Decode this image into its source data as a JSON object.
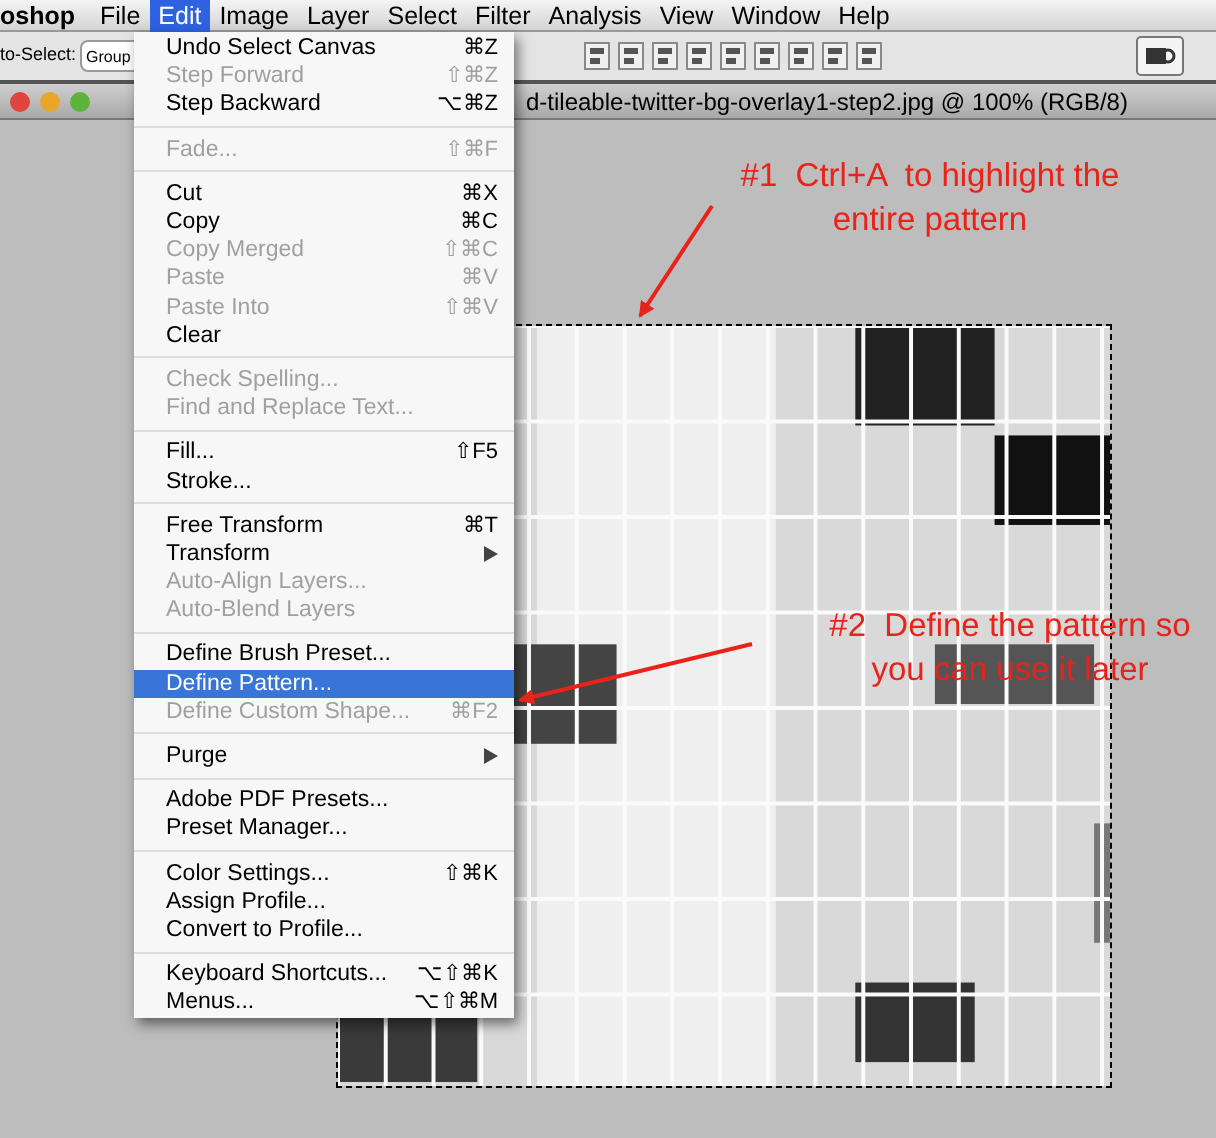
{
  "menubar": [
    {
      "label": "oshop",
      "kind": "app",
      "selected": false
    },
    {
      "label": "File",
      "kind": "menu",
      "selected": false
    },
    {
      "label": "Edit",
      "kind": "menu",
      "selected": true
    },
    {
      "label": "Image",
      "kind": "menu",
      "selected": false
    },
    {
      "label": "Layer",
      "kind": "menu",
      "selected": false
    },
    {
      "label": "Select",
      "kind": "menu",
      "selected": false
    },
    {
      "label": "Filter",
      "kind": "menu",
      "selected": false
    },
    {
      "label": "Analysis",
      "kind": "menu",
      "selected": false
    },
    {
      "label": "View",
      "kind": "menu",
      "selected": false
    },
    {
      "label": "Window",
      "kind": "menu",
      "selected": false
    },
    {
      "label": "Help",
      "kind": "menu",
      "selected": false
    }
  ],
  "options_bar": {
    "auto_select_label": "to-Select:",
    "auto_select_value": "Group"
  },
  "document": {
    "title": "d-tileable-twitter-bg-overlay1-step2.jpg @ 100% (RGB/8)"
  },
  "edit_menu": {
    "sections": [
      [
        {
          "label": "Undo Select Canvas",
          "shortcut": "⌘Z",
          "disabled": false,
          "selected": false,
          "submenu": false
        },
        {
          "label": "Step Forward",
          "shortcut": "⇧⌘Z",
          "disabled": true,
          "selected": false,
          "submenu": false
        },
        {
          "label": "Step Backward",
          "shortcut": "⌥⌘Z",
          "disabled": false,
          "selected": false,
          "submenu": false
        }
      ],
      [
        {
          "label": "Fade...",
          "shortcut": "⇧⌘F",
          "disabled": true,
          "selected": false,
          "submenu": false
        }
      ],
      [
        {
          "label": "Cut",
          "shortcut": "⌘X",
          "disabled": false,
          "selected": false,
          "submenu": false
        },
        {
          "label": "Copy",
          "shortcut": "⌘C",
          "disabled": false,
          "selected": false,
          "submenu": false
        },
        {
          "label": "Copy Merged",
          "shortcut": "⇧⌘C",
          "disabled": true,
          "selected": false,
          "submenu": false
        },
        {
          "label": "Paste",
          "shortcut": "⌘V",
          "disabled": true,
          "selected": false,
          "submenu": false
        },
        {
          "label": "Paste Into",
          "shortcut": "⇧⌘V",
          "disabled": true,
          "selected": false,
          "submenu": false
        },
        {
          "label": "Clear",
          "disabled": false,
          "selected": false,
          "submenu": false
        }
      ],
      [
        {
          "label": "Check Spelling...",
          "disabled": true,
          "selected": false,
          "submenu": false
        },
        {
          "label": "Find and Replace Text...",
          "disabled": true,
          "selected": false,
          "submenu": false
        }
      ],
      [
        {
          "label": "Fill...",
          "shortcut": "⇧F5",
          "disabled": false,
          "selected": false,
          "submenu": false
        },
        {
          "label": "Stroke...",
          "disabled": false,
          "selected": false,
          "submenu": false
        }
      ],
      [
        {
          "label": "Free Transform",
          "shortcut": "⌘T",
          "disabled": false,
          "selected": false,
          "submenu": false
        },
        {
          "label": "Transform",
          "disabled": false,
          "selected": false,
          "submenu": true
        },
        {
          "label": "Auto-Align Layers...",
          "disabled": true,
          "selected": false,
          "submenu": false
        },
        {
          "label": "Auto-Blend Layers",
          "disabled": true,
          "selected": false,
          "submenu": false
        }
      ],
      [
        {
          "label": "Define Brush Preset...",
          "disabled": false,
          "selected": false,
          "submenu": false
        },
        {
          "label": "Define Pattern...",
          "disabled": false,
          "selected": true,
          "submenu": false
        },
        {
          "label": "Define Custom Shape...",
          "shortcut": "⌘F2",
          "disabled": true,
          "selected": false,
          "submenu": false
        }
      ],
      [
        {
          "label": "Purge",
          "disabled": false,
          "selected": false,
          "submenu": true
        }
      ],
      [
        {
          "label": "Adobe PDF Presets...",
          "disabled": false,
          "selected": false,
          "submenu": false
        },
        {
          "label": "Preset Manager...",
          "disabled": false,
          "selected": false,
          "submenu": false
        }
      ],
      [
        {
          "label": "Color Settings...",
          "shortcut": "⇧⌘K",
          "disabled": false,
          "selected": false,
          "submenu": false
        },
        {
          "label": "Assign Profile...",
          "disabled": false,
          "selected": false,
          "submenu": false
        },
        {
          "label": "Convert to Profile...",
          "disabled": false,
          "selected": false,
          "submenu": false
        }
      ],
      [
        {
          "label": "Keyboard Shortcuts...",
          "shortcut": "⌥⇧⌘K",
          "disabled": false,
          "selected": false,
          "submenu": false
        },
        {
          "label": "Menus...",
          "shortcut": "⌥⇧⌘M",
          "disabled": false,
          "selected": false,
          "submenu": false
        }
      ]
    ]
  },
  "annotations": [
    {
      "lines": [
        "#1  Ctrl+A  to highlight the",
        "entire pattern"
      ]
    },
    {
      "lines": [
        "#2  Define the pattern so",
        "you can use it later"
      ]
    }
  ]
}
